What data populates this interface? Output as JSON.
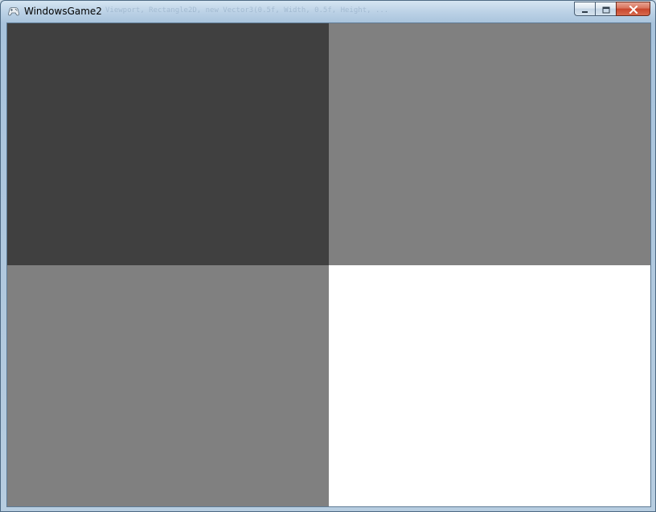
{
  "window": {
    "title": "WindowsGame2",
    "title_ghost": "Viewport, Rectangle2D, new Vector3(0.5f, Width, 0.5f, Height, ...",
    "icon": "gamepad-icon",
    "buttons": {
      "minimize": "minimize-icon",
      "maximize": "maximize-icon",
      "close": "close-icon"
    }
  },
  "colors": {
    "quadrant_top_left": "#404040",
    "quadrant_top_right": "#808080",
    "quadrant_bottom_left": "#808080",
    "quadrant_bottom_right": "#ffffff"
  }
}
